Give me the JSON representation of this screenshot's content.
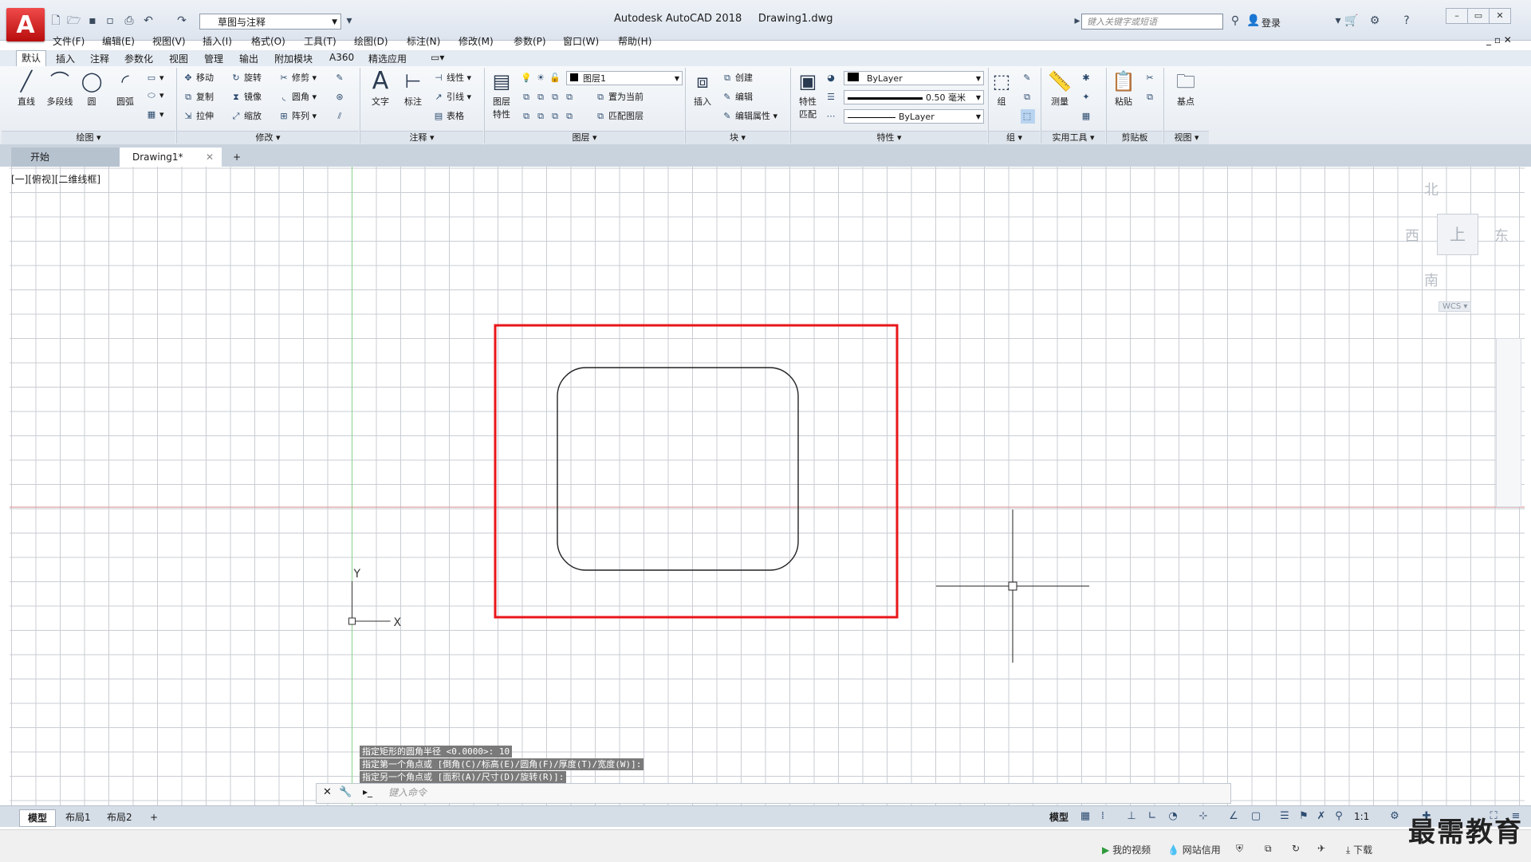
{
  "titlebar": {
    "workspace": "草图与注释",
    "app_title": "Autodesk AutoCAD 2018",
    "doc_title": "Drawing1.dwg",
    "search_placeholder": "键入关键字或短语",
    "login": "登录"
  },
  "menubar": [
    "文件(F)",
    "编辑(E)",
    "视图(V)",
    "插入(I)",
    "格式(O)",
    "工具(T)",
    "绘图(D)",
    "标注(N)",
    "修改(M)",
    "参数(P)",
    "窗口(W)",
    "帮助(H)"
  ],
  "ribbon_tabs": [
    "默认",
    "插入",
    "注释",
    "参数化",
    "视图",
    "管理",
    "输出",
    "附加模块",
    "A360",
    "精选应用"
  ],
  "ribbon": {
    "draw": {
      "title": "绘图",
      "line": "直线",
      "polyline": "多段线",
      "circle": "圆",
      "arc": "圆弧"
    },
    "modify": {
      "title": "修改",
      "move": "移动",
      "rotate": "旋转",
      "trim": "修剪",
      "copy": "复制",
      "mirror": "镜像",
      "fillet": "圆角",
      "stretch": "拉伸",
      "scale": "缩放",
      "array": "阵列"
    },
    "annotation": {
      "title": "注释",
      "text": "文字",
      "dimension": "标注",
      "linear": "线性",
      "leader": "引线",
      "table": "表格"
    },
    "layers": {
      "title": "图层",
      "layer_props_1": "图层",
      "layer_props_2": "特性",
      "current_layer": "图层1",
      "set_current": "置为当前",
      "match_layer": "匹配图层"
    },
    "block": {
      "title": "块",
      "insert": "插入",
      "create": "创建",
      "edit": "编辑",
      "edit_attr": "编辑属性"
    },
    "properties": {
      "title": "特性",
      "match_1": "特性",
      "match_2": "匹配",
      "color": "ByLayer",
      "lineweight": "0.50 毫米",
      "linetype": "ByLayer"
    },
    "groups": {
      "title": "组",
      "group": "组"
    },
    "utilities": {
      "title": "实用工具",
      "measure": "测量"
    },
    "clipboard": {
      "title": "剪贴板",
      "paste": "粘贴"
    },
    "view": {
      "title": "视图",
      "base": "基点"
    }
  },
  "file_tabs": {
    "start": "开始",
    "drawing": "Drawing1*"
  },
  "viewport_label": "[一][俯视][二维线框]",
  "viewcube": {
    "north": "北",
    "south": "南",
    "east": "东",
    "west": "西",
    "face": "上",
    "wcs": "WCS"
  },
  "ucs": {
    "x": "X",
    "y": "Y"
  },
  "command": {
    "history": [
      "指定矩形的圆角半径 <0.0000>: 10",
      "指定第一个角点或 [倒角(C)/标高(E)/圆角(F)/厚度(T)/宽度(W)]:",
      "指定另一个角点或 [面积(A)/尺寸(D)/旋转(R)]:"
    ],
    "placeholder": "键入命令"
  },
  "layout_tabs": [
    "模型",
    "布局1",
    "布局2"
  ],
  "status": {
    "model": "模型",
    "scale": "1:1"
  },
  "taskbar": {
    "my_video": "我的视频",
    "net_credit": "网站信用",
    "download": "下载"
  },
  "watermark": "最需教育",
  "colors": {
    "highlight_rect": "#e8161a",
    "grid": "#c9cdd3",
    "x_axis": "#d98a8a",
    "y_axis": "#8ad08a"
  }
}
